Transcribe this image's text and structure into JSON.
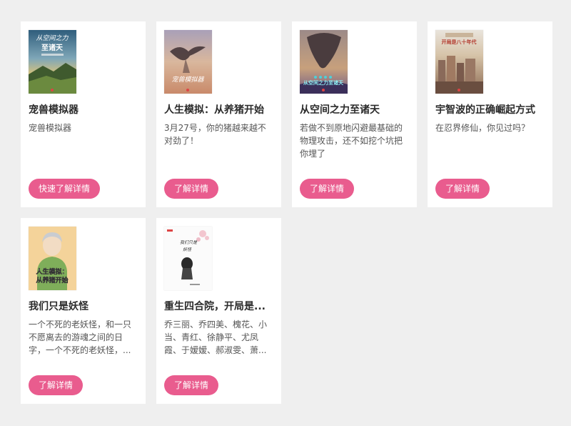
{
  "books": [
    {
      "title": "宠兽模拟器",
      "description": "宠兽模拟器",
      "button_label": "快速了解详情",
      "cover_icon": "book-cover-landscape-icon",
      "cover_text": "从空间之力至诸天"
    },
    {
      "title": "人生模拟：从养猪开始",
      "description": "3月27号，你的猪越来越不对劲了！",
      "button_label": "了解详情",
      "cover_icon": "book-cover-bird-icon",
      "cover_text": "宠兽模拟器"
    },
    {
      "title": "从空间之力至诸天",
      "description": "若做不到原地闪避最基础的物理攻击，还不如挖个坑把你埋了",
      "button_label": "了解详情",
      "cover_icon": "book-cover-island-icon",
      "cover_text": "从空间之力至诸天"
    },
    {
      "title": "宇智波的正确崛起方式",
      "description": "在忍界修仙，你见过吗？",
      "button_label": "了解详情",
      "cover_icon": "book-cover-city-icon",
      "cover_text": "开局是八十年代"
    },
    {
      "title": "我们只是妖怪",
      "description": "一个不死的老妖怪，和一只不愿离去的游魂之间的日字，一个不死的老妖怪，...",
      "button_label": "了解详情",
      "cover_icon": "book-cover-boy-icon",
      "cover_text": "人生模拟：从养猪开始"
    },
    {
      "title": "重生四合院，开局是...",
      "description": "乔三丽、乔四美、槐花、小当、青红、徐静平、尤凤霞、于嫒嫒、郝淑雯、萧...",
      "button_label": "了解详情",
      "cover_icon": "book-cover-ink-icon",
      "cover_text": "我们只是妖怪"
    }
  ],
  "colors": {
    "page_background": "#efefef",
    "card_background": "#ffffff",
    "button_background": "#e95c8e",
    "button_text": "#ffffff"
  }
}
